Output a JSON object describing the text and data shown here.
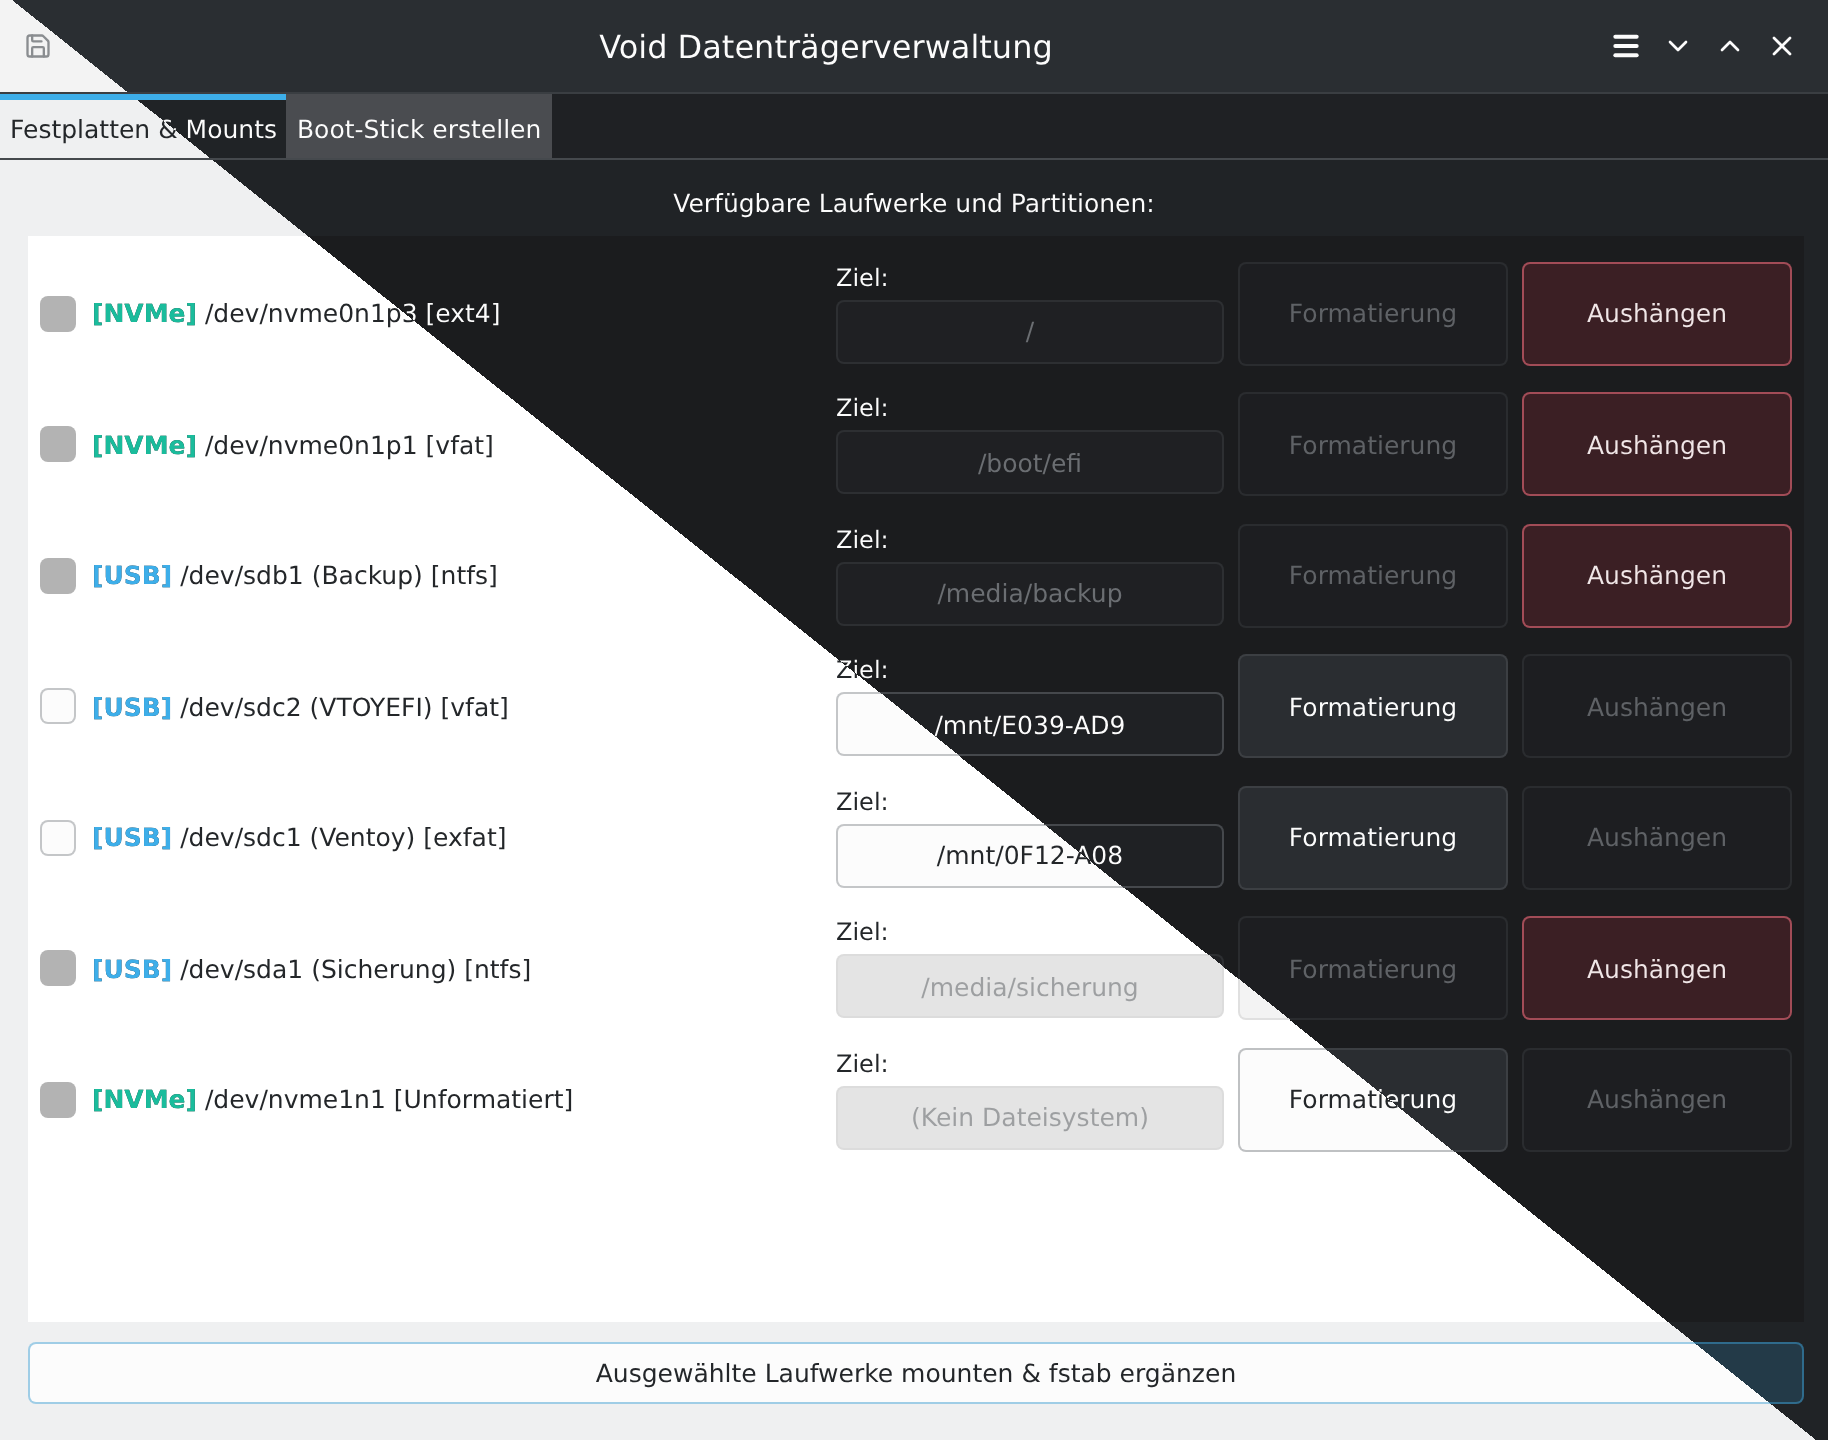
{
  "window": {
    "title": "Void Datenträgerverwaltung"
  },
  "tabs": [
    {
      "label": "Festplatten & Mounts",
      "selected": true
    },
    {
      "label": "Boot-Stick erstellen",
      "selected": false
    }
  ],
  "heading": "Verfügbare Laufwerke und Partitionen:",
  "drives": [
    {
      "bus": "[NVMe]",
      "color": "#1abc9c",
      "name": "/dev/nvme0n1p3 [ext4]",
      "disabled": true,
      "target_label": "Ziel:",
      "target": "/",
      "target_disabled": true,
      "format": {
        "label": "Formatierung",
        "disabled": true
      },
      "unmount": {
        "label": "Aushängen",
        "disabled": false
      }
    },
    {
      "bus": "[NVMe]",
      "color": "#1abc9c",
      "name": "/dev/nvme0n1p1 [vfat]",
      "disabled": true,
      "target_label": "Ziel:",
      "target": "/boot/efi",
      "target_disabled": true,
      "format": {
        "label": "Formatierung",
        "disabled": true
      },
      "unmount": {
        "label": "Aushängen",
        "disabled": false
      }
    },
    {
      "bus": "[USB]",
      "color": "#3daee9",
      "name": "/dev/sdb1 (Backup) [ntfs]",
      "disabled": true,
      "target_label": "Ziel:",
      "target": "/media/backup",
      "target_disabled": true,
      "format": {
        "label": "Formatierung",
        "disabled": true
      },
      "unmount": {
        "label": "Aushängen",
        "disabled": false
      }
    },
    {
      "bus": "[USB]",
      "color": "#3daee9",
      "name": "/dev/sdc2 (VTOYEFI) [vfat]",
      "disabled": false,
      "target_label": "Ziel:",
      "target": "/mnt/E039-AD9",
      "target_disabled": false,
      "format": {
        "label": "Formatierung",
        "disabled": false
      },
      "unmount": {
        "label": "Aushängen",
        "disabled": true
      }
    },
    {
      "bus": "[USB]",
      "color": "#3daee9",
      "name": "/dev/sdc1 (Ventoy) [exfat]",
      "disabled": false,
      "target_label": "Ziel:",
      "target": "/mnt/0F12-A08",
      "target_disabled": false,
      "format": {
        "label": "Formatierung",
        "disabled": false
      },
      "unmount": {
        "label": "Aushängen",
        "disabled": true
      }
    },
    {
      "bus": "[USB]",
      "color": "#3daee9",
      "name": "/dev/sda1 (Sicherung) [ntfs]",
      "disabled": true,
      "target_label": "Ziel:",
      "target": "/media/sicherung",
      "target_disabled": true,
      "format": {
        "label": "Formatierung",
        "disabled": true
      },
      "unmount": {
        "label": "Aushängen",
        "disabled": false
      }
    },
    {
      "bus": "[NVMe]",
      "color": "#1abc9c",
      "name": "/dev/nvme1n1 [Unformatiert]",
      "disabled": true,
      "target_label": "Ziel:",
      "target": "(Kein Dateisystem)",
      "target_disabled": true,
      "format": {
        "label": "Formatierung",
        "disabled": false
      },
      "unmount": {
        "label": "Aushängen",
        "disabled": true
      }
    }
  ],
  "apply_button": "Ausgewählte Laufwerke mounten & fstab ergänzen"
}
